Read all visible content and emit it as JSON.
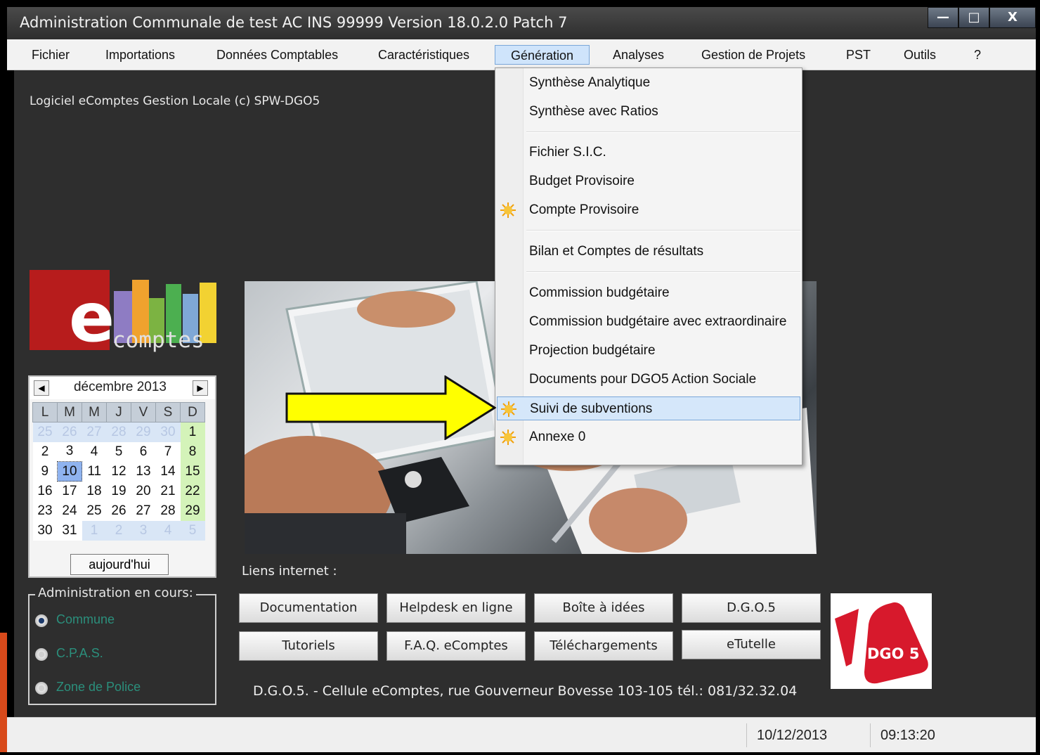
{
  "window": {
    "title": "Administration Communale de  test AC     INS 99999     Version 18.0.2.0 Patch 7",
    "minimize": "—",
    "maximize": "□",
    "close": "X"
  },
  "menubar": {
    "items": [
      "Fichier",
      "Importations",
      "Données Comptables",
      "Caractéristiques",
      "Génération",
      "Analyses",
      "Gestion de Projets",
      "PST",
      "Outils",
      "?"
    ],
    "active": "Génération"
  },
  "main": {
    "subtitle": "Logiciel eComptes Gestion Locale (c) SPW-DGO5",
    "logo": {
      "letter": "e",
      "word": "comptes"
    }
  },
  "calendar": {
    "month": "décembre 2013",
    "prev": "◀",
    "next": "▶",
    "weekdays": [
      "L",
      "M",
      "M",
      "J",
      "V",
      "S",
      "D"
    ],
    "weeks": [
      [
        "25",
        "26",
        "27",
        "28",
        "29",
        "30",
        "1"
      ],
      [
        "2",
        "3",
        "4",
        "5",
        "6",
        "7",
        "8"
      ],
      [
        "9",
        "10",
        "11",
        "12",
        "13",
        "14",
        "15"
      ],
      [
        "16",
        "17",
        "18",
        "19",
        "20",
        "21",
        "22"
      ],
      [
        "23",
        "24",
        "25",
        "26",
        "27",
        "28",
        "29"
      ],
      [
        "30",
        "31",
        "1",
        "2",
        "3",
        "4",
        "5"
      ]
    ],
    "today_button": "aujourd'hui",
    "selected": "10"
  },
  "admin": {
    "label": "Administration en cours:",
    "options": [
      "Commune",
      "C.P.A.S.",
      "Zone de Police"
    ],
    "selected": "Commune"
  },
  "links": {
    "label": "Liens internet :",
    "buttons": [
      "Documentation",
      "Helpdesk en ligne",
      "Boîte à idées",
      "D.G.O.5",
      "Tutoriels",
      "F.A.Q. eComptes",
      "Téléchargements",
      "eTutelle"
    ]
  },
  "footer": {
    "address": "D.G.O.5. - Cellule eComptes, rue Gouverneur Bovesse 103-105 tél.: 081/32.32.04",
    "dgo_logo": "DGO 5"
  },
  "status": {
    "date": "10/12/2013",
    "time": "09:13:20"
  },
  "dropdown": {
    "items": [
      {
        "label": "Synthèse Analytique",
        "icon": ""
      },
      {
        "label": "Synthèse avec Ratios",
        "icon": ""
      },
      {
        "label": "Fichier S.I.C.",
        "icon": ""
      },
      {
        "label": "Budget Provisoire",
        "icon": ""
      },
      {
        "label": "Compte Provisoire",
        "icon": "sun-icon"
      },
      {
        "label": "Bilan et Comptes de résultats",
        "icon": ""
      },
      {
        "label": "Commission budgétaire",
        "icon": ""
      },
      {
        "label": "Commission budgétaire avec extraordinaire",
        "icon": ""
      },
      {
        "label": "Projection budgétaire",
        "icon": ""
      },
      {
        "label": "Documents pour DGO5 Action Sociale",
        "icon": ""
      },
      {
        "label": "Suivi de subventions",
        "icon": "sun-icon"
      },
      {
        "label": "Annexe 0",
        "icon": "sun-icon"
      }
    ],
    "highlighted": "Suivi de subventions"
  },
  "colors": {
    "accent_red": "#b71c1c",
    "arrow_yellow": "#ffff00",
    "menu_highlight": "#d5e7fa",
    "background": "#2e2e2e"
  }
}
